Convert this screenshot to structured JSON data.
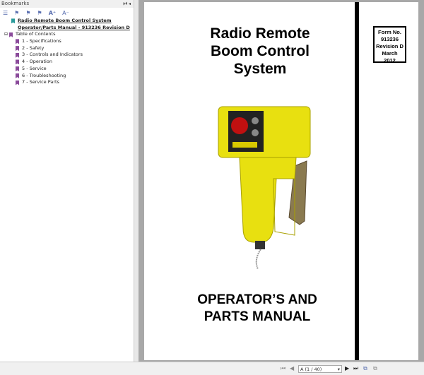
{
  "bookmarks": {
    "title": "Bookmarks",
    "root": [
      "Radio Remote Boom Control System",
      "Operator/Parts Manual - 913236 Revision D"
    ],
    "toc": "Table of Contents",
    "items": [
      "1 - Specifications",
      "2 - Safety",
      "3 - Controls and Indicators",
      "4 - Operation",
      "5 - Service",
      "6 - Troubleshooting",
      "7 - Service Parts"
    ],
    "colors": {
      "root": "#2a9a9a",
      "item": "#8a4a9a"
    }
  },
  "document": {
    "title": [
      "Radio Remote",
      "Boom Control",
      "System"
    ],
    "form": [
      "Form No.",
      "913236",
      "Revision D",
      "March",
      "2012"
    ],
    "subtitle": [
      "OPERATOR’S AND",
      "PARTS MANUAL"
    ]
  },
  "nav": {
    "page_indicator": "A (1 / 40)"
  }
}
